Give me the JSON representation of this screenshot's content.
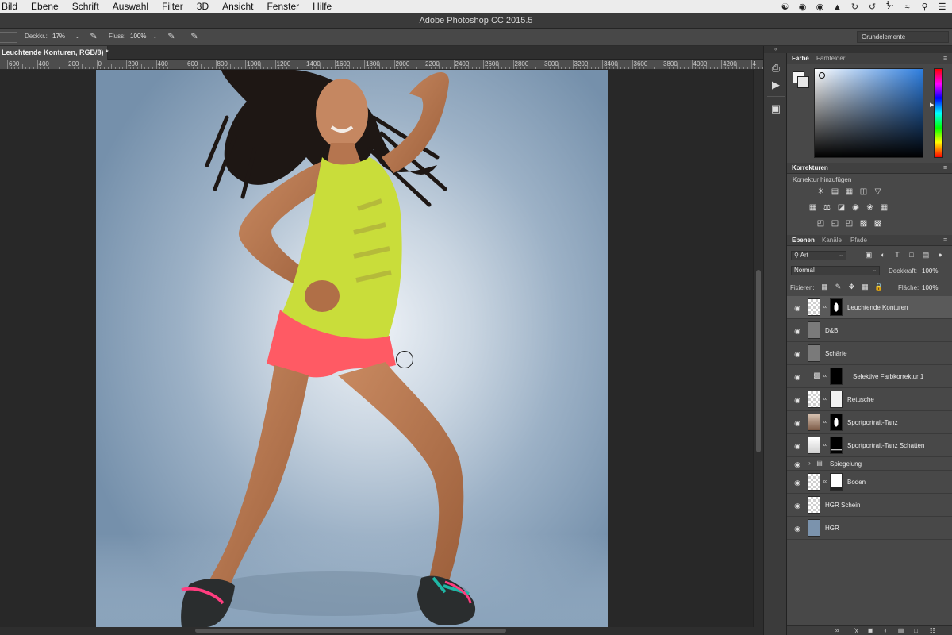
{
  "menubar": {
    "items": [
      "Bild",
      "Ebene",
      "Schrift",
      "Auswahl",
      "Filter",
      "3D",
      "Ansicht",
      "Fenster",
      "Hilfe"
    ],
    "tray_icons": [
      "creative-cloud-icon",
      "camera-icon",
      "record-icon",
      "drive-icon",
      "sync-icon",
      "time-machine-icon",
      "bluetooth-icon",
      "wifi-icon",
      "search-icon",
      "list-icon"
    ]
  },
  "titlebar": {
    "title": "Adobe Photoshop CC 2015.5"
  },
  "options": {
    "opacity_label": "Deckkr.:",
    "opacity_value": "17%",
    "flow_label": "Fluss:",
    "flow_value": "100%",
    "workspace": "Grundelemente"
  },
  "document": {
    "tab_title": "Leuchtende Konturen, RGB/8) *"
  },
  "ruler": {
    "labels": [
      "600",
      "400",
      "200",
      "0",
      "200",
      "400",
      "600",
      "800",
      "1000",
      "1200",
      "1400",
      "1600",
      "1800",
      "2000",
      "2200",
      "2400",
      "2600",
      "2800",
      "3000",
      "3200",
      "3400",
      "3600",
      "3800",
      "4000",
      "4200",
      "4"
    ]
  },
  "color_panel": {
    "tabs": [
      "Farbe",
      "Farbfelder"
    ],
    "foreground": "#f4f4f4",
    "background": "#e6e6e6"
  },
  "adjustments_panel": {
    "title": "Korrekturen",
    "subtitle": "Korrektur hinzufügen"
  },
  "layers_panel": {
    "tabs": [
      "Ebenen",
      "Kanäle",
      "Pfade"
    ],
    "filter": "Art",
    "blend_mode": "Normal",
    "opacity_label": "Deckkraft:",
    "opacity_value": "100%",
    "lock_label": "Fixieren:",
    "fill_label": "Fläche:",
    "fill_value": "100%",
    "layers": [
      {
        "name": "Leuchtende Konturen",
        "selected": true
      },
      {
        "name": "D&B"
      },
      {
        "name": "Schärfe"
      },
      {
        "name": "Selektive Farbkorrektur 1"
      },
      {
        "name": "Retusche"
      },
      {
        "name": "Sportportrait-Tanz"
      },
      {
        "name": "Sportportrait-Tanz Schatten"
      },
      {
        "name": "Spiegelung",
        "group": true
      },
      {
        "name": "Boden"
      },
      {
        "name": "HGR Schein"
      },
      {
        "name": "HGR"
      }
    ]
  },
  "colors": {
    "accent": "#2f7fe0",
    "panel": "#484848",
    "hgr": "#7b93ad"
  }
}
